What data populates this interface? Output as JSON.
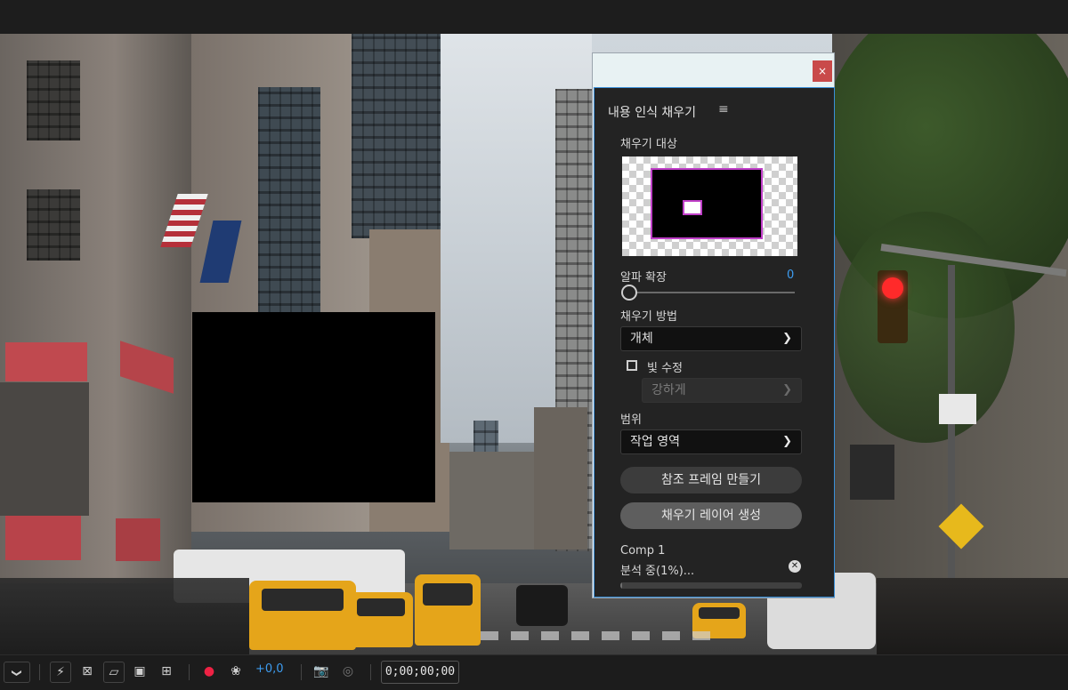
{
  "panel": {
    "close_label": "×",
    "title": "내용 인식 채우기",
    "menu_icon": "≡",
    "fill_target_label": "채우기 대상",
    "alpha_expand_label": "알파 확장",
    "alpha_expand_value": "0",
    "fill_method_label": "채우기 방법",
    "fill_method_value": "개체",
    "lighting_correction_label": "빛 수정",
    "lighting_correction_checked": false,
    "lighting_strength_value": "강하게",
    "range_label": "범위",
    "range_value": "작업 영역",
    "create_reference_frame_label": "참조 프레임 만들기",
    "generate_fill_layer_label": "채우기 레이어 생성",
    "comp_name": "Comp 1",
    "status": "분석 중(1%)...",
    "progress_fraction": 0.01
  },
  "toolbar": {
    "exposure_value": "+0,0",
    "timecode": "0;00;00;00"
  },
  "colors": {
    "accent_blue": "#3d9cf0",
    "panel_bg": "#232323",
    "mask_outline": "#c03fc8",
    "close_red": "#c94a4a"
  },
  "icons": [
    "chevron-down-icon",
    "toggle-transparency-icon",
    "region-of-interest-icon",
    "mask-path-icon",
    "safe-margins-icon",
    "grid-icon",
    "color-channels-icon",
    "exposure-reset-icon",
    "snapshot-icon",
    "show-snapshot-icon"
  ]
}
